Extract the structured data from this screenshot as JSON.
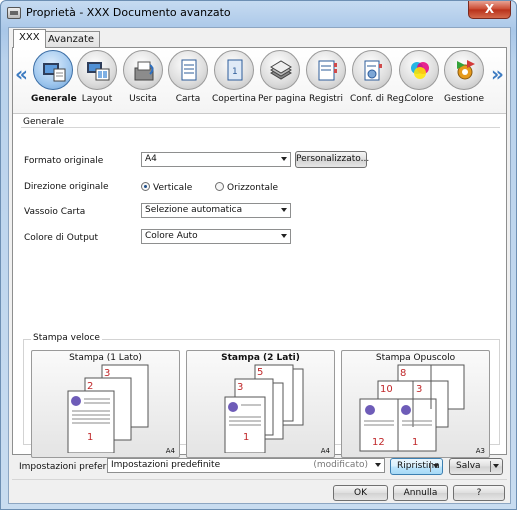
{
  "window": {
    "title": "Proprietà - XXX Documento avanzato",
    "close_label": "X"
  },
  "tabs": [
    "XXX",
    "Avanzate"
  ],
  "categories": [
    {
      "label": "Generale",
      "icon": "generale-icon"
    },
    {
      "label": "Layout",
      "icon": "layout-icon"
    },
    {
      "label": "Uscita",
      "icon": "uscita-icon"
    },
    {
      "label": "Carta",
      "icon": "carta-icon"
    },
    {
      "label": "Copertina",
      "icon": "copertina-icon"
    },
    {
      "label": "Per pagina",
      "icon": "per-pagina-icon"
    },
    {
      "label": "Registri",
      "icon": "registri-icon"
    },
    {
      "label": "Conf. di Reg.",
      "icon": "conf-reg-icon"
    },
    {
      "label": "Colore",
      "icon": "colore-icon"
    },
    {
      "label": "Gestione",
      "icon": "gestione-icon"
    }
  ],
  "general": {
    "section_title": "Generale",
    "formato_label": "Formato originale",
    "formato_value": "A4",
    "personalizzato_button": "Personalizzato...",
    "direzione_label": "Direzione originale",
    "verticale": "Verticale",
    "orizzontale": "Orizzontale",
    "vassoio_label": "Vassoio Carta",
    "vassoio_value": "Selezione automatica",
    "colore_label": "Colore di Output",
    "colore_value": "Colore Auto"
  },
  "quick_print": {
    "title": "Stampa veloce",
    "cards": [
      {
        "name": "Stampa (1 Lato)",
        "size": "A4"
      },
      {
        "name": "Stampa (2 Lati)",
        "size": "A4"
      },
      {
        "name": "Stampa Opuscolo",
        "size": "A3"
      }
    ]
  },
  "bottom": {
    "pref_label": "Impostazioni preferite",
    "pref_value": "Impostazioni predefinite",
    "pref_modified": "(modificato)",
    "ripristina": "Ripristina",
    "salva": "Salva",
    "ok": "OK",
    "annulla": "Annulla",
    "help": "?"
  },
  "colors": {
    "accent": "#3d7bc1",
    "page_number": "#c0282a"
  }
}
